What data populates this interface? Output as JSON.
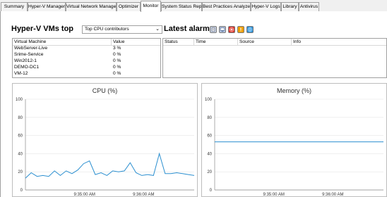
{
  "tabs": [
    {
      "label": "Summary"
    },
    {
      "label": "Hyper-V Manager"
    },
    {
      "label": "Virtual Network Manager"
    },
    {
      "label": "Optimizer"
    },
    {
      "label": "Monitor"
    },
    {
      "label": "System Status Report"
    },
    {
      "label": "Best Practices Analyzer"
    },
    {
      "label": "Hyper-V Logs"
    },
    {
      "label": "Library"
    },
    {
      "label": "Antivirus"
    }
  ],
  "active_tab": "Monitor",
  "vms_top": {
    "title": "Hyper-V VMs top",
    "selector_value": "Top CPU contributors",
    "columns": [
      "Virtual Machine",
      "Value"
    ],
    "rows": [
      {
        "name": "WebServer-Live",
        "value": "3 %"
      },
      {
        "name": "Srime-Service",
        "value": "0 %"
      },
      {
        "name": "Win2012-1",
        "value": "0 %"
      },
      {
        "name": "DEMO-DC1",
        "value": "0 %"
      },
      {
        "name": "VM-12",
        "value": "0 %"
      }
    ]
  },
  "alarms": {
    "title": "Latest alarms",
    "columns": [
      "Status",
      "Time",
      "Source",
      "Info"
    ],
    "buttons": [
      {
        "icon": "list-alarms-icon",
        "color": "#9aa7bf"
      },
      {
        "icon": "monitor-alarms-icon",
        "color": "#7f96bf"
      },
      {
        "icon": "error-alarms-icon",
        "color": "#d9342b"
      },
      {
        "icon": "warning-alarms-icon",
        "color": "#f0a000"
      },
      {
        "icon": "info-alarms-icon",
        "color": "#2a8fd6"
      }
    ]
  },
  "chart_data": [
    {
      "type": "line",
      "title": "CPU (%)",
      "ylim": [
        0,
        100
      ],
      "yticks": [
        "0",
        "20",
        "40",
        "60",
        "80",
        "100"
      ],
      "xticks": [
        "9:35:00 AM",
        "9:36:00 AM"
      ],
      "color": "#2b8fd0",
      "series": [
        {
          "values": [
            13,
            19,
            15,
            16,
            15,
            21,
            16,
            21,
            18,
            22,
            29,
            32,
            17,
            19,
            16,
            21,
            20,
            21,
            30,
            19,
            16,
            17,
            16,
            40,
            18,
            18,
            19,
            18,
            17,
            16
          ]
        }
      ]
    },
    {
      "type": "line",
      "title": "Memory (%)",
      "ylim": [
        0,
        100
      ],
      "yticks": [
        "0",
        "20",
        "40",
        "60",
        "80",
        "100"
      ],
      "xticks": [
        "9:35:00 AM",
        "9:36:00 AM"
      ],
      "color": "#2b8fd0",
      "series": [
        {
          "values": [
            53,
            53,
            53,
            53,
            53,
            53,
            53,
            53,
            53,
            53,
            53,
            53,
            53,
            53,
            53,
            53,
            53,
            53,
            53,
            53,
            53,
            53,
            53,
            53,
            53,
            53,
            53,
            53,
            53,
            53
          ]
        }
      ]
    }
  ]
}
